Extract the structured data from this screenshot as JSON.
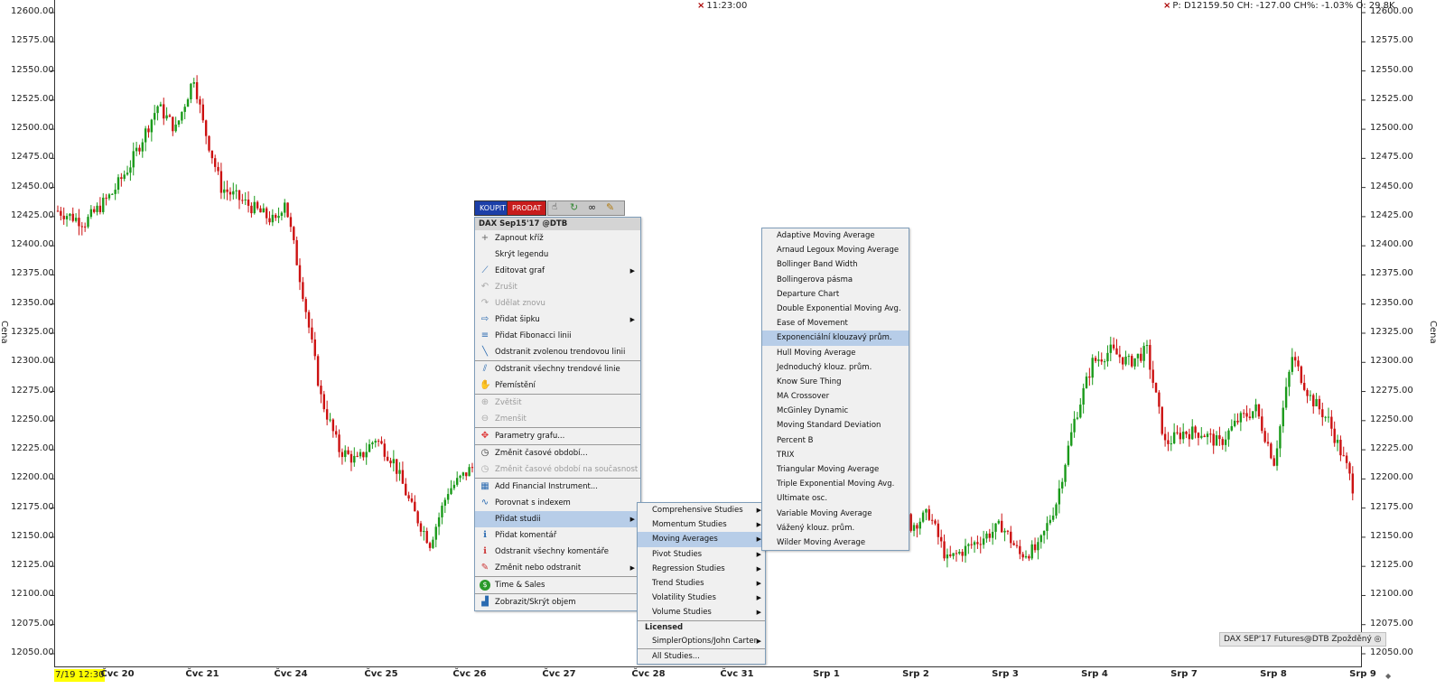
{
  "top_center": {
    "label": "11:23:00"
  },
  "top_right": {
    "label": "P: D12159.50 CH: -127.00 CH%: -1.03% O: 29.8K"
  },
  "y_axis": {
    "caption": "Cena",
    "ticks": [
      "12600.00",
      "12575.00",
      "12550.00",
      "12525.00",
      "12500.00",
      "12475.00",
      "12450.00",
      "12425.00",
      "12400.00",
      "12375.00",
      "12350.00",
      "12325.00",
      "12300.00",
      "12275.00",
      "12250.00",
      "12225.00",
      "12200.00",
      "12175.00",
      "12150.00",
      "12125.00",
      "12100.00",
      "12075.00",
      "12050.00"
    ]
  },
  "x_axis": {
    "highlighted_date": "7/19 12:30",
    "ticks": [
      "Čvc 20",
      "Čvc 21",
      "Čvc 24",
      "Čvc 25",
      "Čvc 26",
      "Čvc 27",
      "Čvc 28",
      "Čvc 31",
      "Srp 1",
      "Srp 2",
      "Srp 3",
      "Srp 4",
      "Srp 7",
      "Srp 8",
      "Srp 9"
    ]
  },
  "watermark": "DAX SEP'17 Futures@DTB Zpožděný",
  "trade_buttons": {
    "buy": "KOUPIT",
    "sell": "PRODAT"
  },
  "context_menu": {
    "title": "DAX Sep15'17 @DTB",
    "items": [
      {
        "label": "Zapnout kříž",
        "icon": "crosshair-icon"
      },
      {
        "label": "Skrýt legendu",
        "icon": ""
      },
      {
        "label": "Editovat graf",
        "icon": "edit-chart-icon",
        "submenu": true
      },
      {
        "label": "Zrušit",
        "icon": "undo-icon",
        "disabled": true
      },
      {
        "label": "Udělat znovu",
        "icon": "redo-icon",
        "disabled": true
      },
      {
        "label": "Přidat šipku",
        "icon": "arrow-icon",
        "submenu": true
      },
      {
        "label": "Přidat Fibonacci linii",
        "icon": "fibonacci-icon"
      },
      {
        "label": "Odstranit zvolenou trendovou linii",
        "icon": "trendline-icon"
      },
      {
        "label": "Odstranit všechny trendové linie",
        "icon": "trendlines-icon",
        "sep": true
      },
      {
        "label": "Přemístění",
        "icon": "hand-icon"
      },
      {
        "label": "Zvětšit",
        "icon": "zoom-in-icon",
        "disabled": true,
        "sep": true
      },
      {
        "label": "Zmenšit",
        "icon": "zoom-out-icon",
        "disabled": true
      },
      {
        "label": "Parametry grafu...",
        "icon": "chart-params-icon",
        "sep": true
      },
      {
        "label": "Změnit časové období...",
        "icon": "clock-icon",
        "sep": true
      },
      {
        "label": "Změnit časové období na současnost",
        "icon": "clock-now-icon",
        "disabled": true
      },
      {
        "label": "Add Financial Instrument...",
        "icon": "add-instrument-icon",
        "sep": true
      },
      {
        "label": "Porovnat s indexem",
        "icon": "compare-icon"
      },
      {
        "label": "Přidat studii",
        "icon": "",
        "submenu": true,
        "selected": true
      },
      {
        "label": "Přidat komentář",
        "icon": "comment-icon"
      },
      {
        "label": "Odstranit všechny komentáře",
        "icon": "remove-comments-icon"
      },
      {
        "label": "Změnit nebo odstranit",
        "icon": "pencil-icon",
        "submenu": true
      },
      {
        "label": "Time & Sales",
        "icon": "dollar-icon",
        "sep": true
      },
      {
        "label": "Zobrazit/Skrýt objem",
        "icon": "volume-icon",
        "sep": true
      }
    ]
  },
  "studies_menu": {
    "items": [
      {
        "label": "Comprehensive Studies",
        "submenu": true
      },
      {
        "label": "Momentum Studies",
        "submenu": true
      },
      {
        "label": "Moving Averages",
        "submenu": true,
        "selected": true
      },
      {
        "label": "Pivot Studies",
        "submenu": true
      },
      {
        "label": "Regression Studies",
        "submenu": true
      },
      {
        "label": "Trend Studies",
        "submenu": true
      },
      {
        "label": "Volatility Studies",
        "submenu": true
      },
      {
        "label": "Volume Studies",
        "submenu": true
      }
    ],
    "licensed_header": "Licensed",
    "licensed_items": [
      {
        "label": "SimplerOptions/John Carter",
        "submenu": true
      }
    ],
    "all_studies": "All Studies..."
  },
  "moving_averages_menu": {
    "items": [
      "Adaptive Moving Average",
      "Arnaud Legoux Moving Average",
      "Bollinger Band Width",
      "Bollingerova pásma",
      "Departure Chart",
      "Double Exponential Moving Avg.",
      "Ease of Movement",
      "Exponenciální klouzavý prům.",
      "Hull Moving Average",
      "Jednoduchý klouz. prům.",
      "Know Sure Thing",
      "MA Crossover",
      "McGinley Dynamic",
      "Moving Standard Deviation",
      "Percent B",
      "TRIX",
      "Triangular Moving Average",
      "Triple Exponential Moving Avg.",
      "Ultimate osc.",
      "Variable Moving Average",
      "Vážený klouz. prům.",
      "Wilder Moving Average"
    ],
    "selected_index": 7
  },
  "chart_data": {
    "type": "candlestick",
    "colors": {
      "up": "#1a9a1a",
      "down": "#cc1111"
    },
    "ylim": [
      12040,
      12605
    ],
    "anchors": [
      [
        0,
        12430
      ],
      [
        3,
        12420
      ],
      [
        6,
        12445
      ],
      [
        8,
        12470
      ],
      [
        11,
        12520
      ],
      [
        13,
        12500
      ],
      [
        15,
        12545
      ],
      [
        16,
        12505
      ],
      [
        18,
        12450
      ],
      [
        20,
        12440
      ],
      [
        22,
        12430
      ],
      [
        24,
        12420
      ],
      [
        25,
        12440
      ],
      [
        27,
        12360
      ],
      [
        29,
        12270
      ],
      [
        31,
        12225
      ],
      [
        33,
        12215
      ],
      [
        35,
        12235
      ],
      [
        37,
        12215
      ],
      [
        39,
        12175
      ],
      [
        41,
        12145
      ],
      [
        43,
        12190
      ],
      [
        45,
        12205
      ],
      [
        47,
        12220
      ],
      [
        49,
        12240
      ],
      [
        51,
        12220
      ],
      [
        53,
        12250
      ],
      [
        55,
        12280
      ],
      [
        57,
        12275
      ],
      [
        59,
        12250
      ],
      [
        61,
        12252
      ],
      [
        86,
        12245
      ],
      [
        88,
        12270
      ],
      [
        90,
        12235
      ],
      [
        92,
        12200
      ],
      [
        94,
        12160
      ],
      [
        96,
        12170
      ],
      [
        98,
        12130
      ],
      [
        100,
        12140
      ],
      [
        102,
        12150
      ],
      [
        104,
        12160
      ],
      [
        106,
        12135
      ],
      [
        108,
        12140
      ],
      [
        110,
        12180
      ],
      [
        112,
        12250
      ],
      [
        114,
        12300
      ],
      [
        116,
        12310
      ],
      [
        118,
        12300
      ],
      [
        120,
        12310
      ],
      [
        122,
        12230
      ],
      [
        124,
        12240
      ],
      [
        126,
        12240
      ],
      [
        128,
        12230
      ],
      [
        130,
        12250
      ],
      [
        132,
        12260
      ],
      [
        134,
        12215
      ],
      [
        136,
        12305
      ],
      [
        138,
        12270
      ],
      [
        140,
        12250
      ],
      [
        142,
        12210
      ],
      [
        144,
        12160
      ],
      [
        145,
        12155
      ]
    ]
  }
}
